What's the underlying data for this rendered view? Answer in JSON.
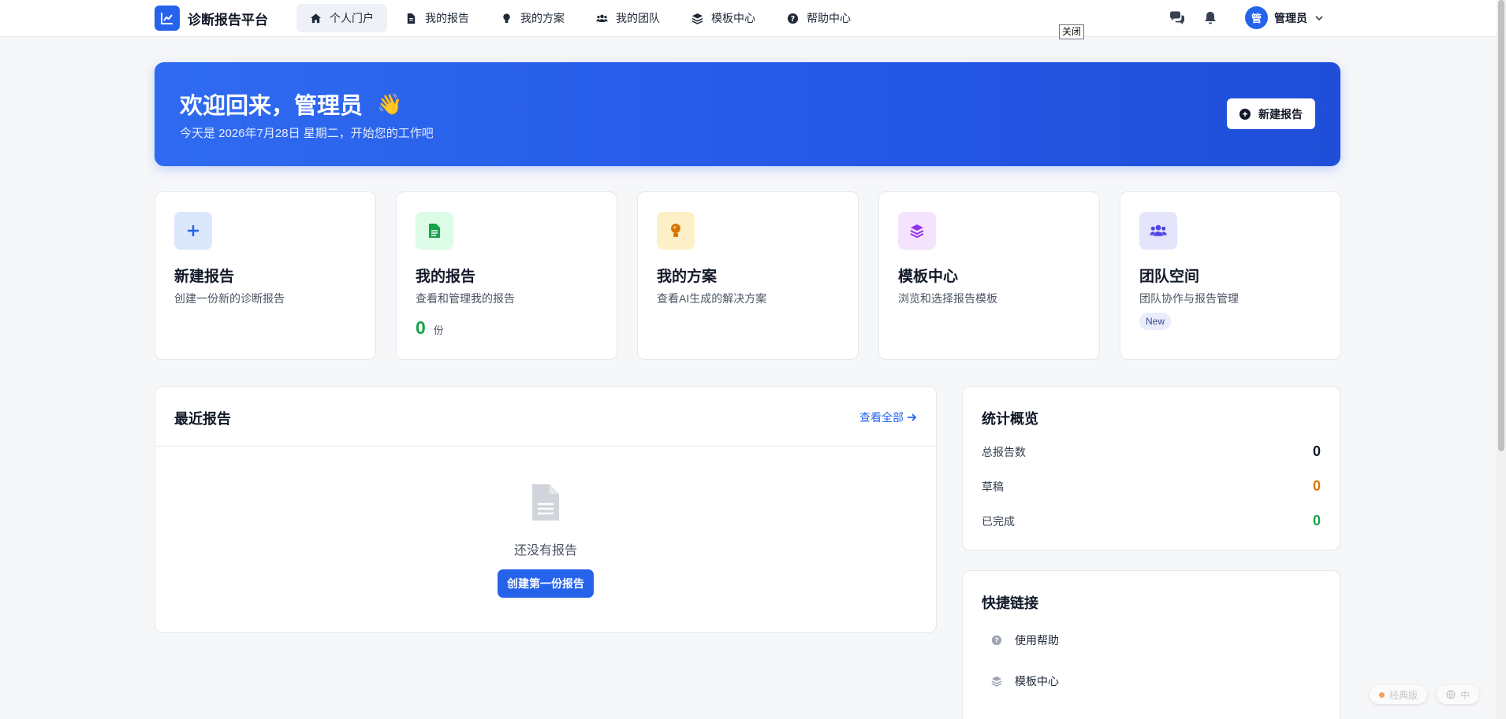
{
  "nav": {
    "brand": "诊断报告平台",
    "items": [
      {
        "label": "个人门户",
        "icon": "home-icon"
      },
      {
        "label": "我的报告",
        "icon": "file-icon"
      },
      {
        "label": "我的方案",
        "icon": "lightbulb-icon"
      },
      {
        "label": "我的团队",
        "icon": "users-icon"
      },
      {
        "label": "模板中心",
        "icon": "layers-icon"
      },
      {
        "label": "帮助中心",
        "icon": "question-circle-icon"
      }
    ],
    "tooltip": "关闭",
    "user": {
      "avatar_char": "管",
      "name": "管理员"
    }
  },
  "hero": {
    "title": "欢迎回来，管理员",
    "wave": "👋",
    "subtitle": "今天是 2026年7月28日 星期二，开始您的工作吧",
    "button": "新建报告"
  },
  "cards": [
    {
      "title": "新建报告",
      "desc": "创建一份新的诊断报告",
      "icon": "plus-icon",
      "icon_color": "#2563eb",
      "icon_bg": "#dbe7fb"
    },
    {
      "title": "我的报告",
      "desc": "查看和管理我的报告",
      "icon": "file-icon",
      "icon_color": "#16a34a",
      "icon_bg": "#dcfce7",
      "stat_value": "0",
      "stat_unit": "份"
    },
    {
      "title": "我的方案",
      "desc": "查看AI生成的解决方案",
      "icon": "lightbulb-icon",
      "icon_color": "#d97706",
      "icon_bg": "#fdf0c8"
    },
    {
      "title": "模板中心",
      "desc": "浏览和选择报告模板",
      "icon": "layers-icon",
      "icon_color": "#9333ea",
      "icon_bg": "#f3e3fc"
    },
    {
      "title": "团队空间",
      "desc": "团队协作与报告管理",
      "icon": "users-icon",
      "icon_color": "#4f46e5",
      "icon_bg": "#e4e4fb",
      "badge": "New"
    }
  ],
  "recent": {
    "title": "最近报告",
    "view_all": "查看全部",
    "empty_text": "还没有报告",
    "empty_button": "创建第一份报告"
  },
  "stats": {
    "title": "统计概览",
    "rows": [
      {
        "label": "总报告数",
        "value": "0",
        "color": "#111827"
      },
      {
        "label": "草稿",
        "value": "0",
        "color": "#d97706"
      },
      {
        "label": "已完成",
        "value": "0",
        "color": "#16a34a"
      }
    ]
  },
  "links": {
    "title": "快捷链接",
    "items": [
      {
        "label": "使用帮助",
        "icon": "question-circle-icon"
      },
      {
        "label": "模板中心",
        "icon": "layers-icon"
      }
    ]
  },
  "float": {
    "classic": "经典版",
    "lang": "中"
  }
}
